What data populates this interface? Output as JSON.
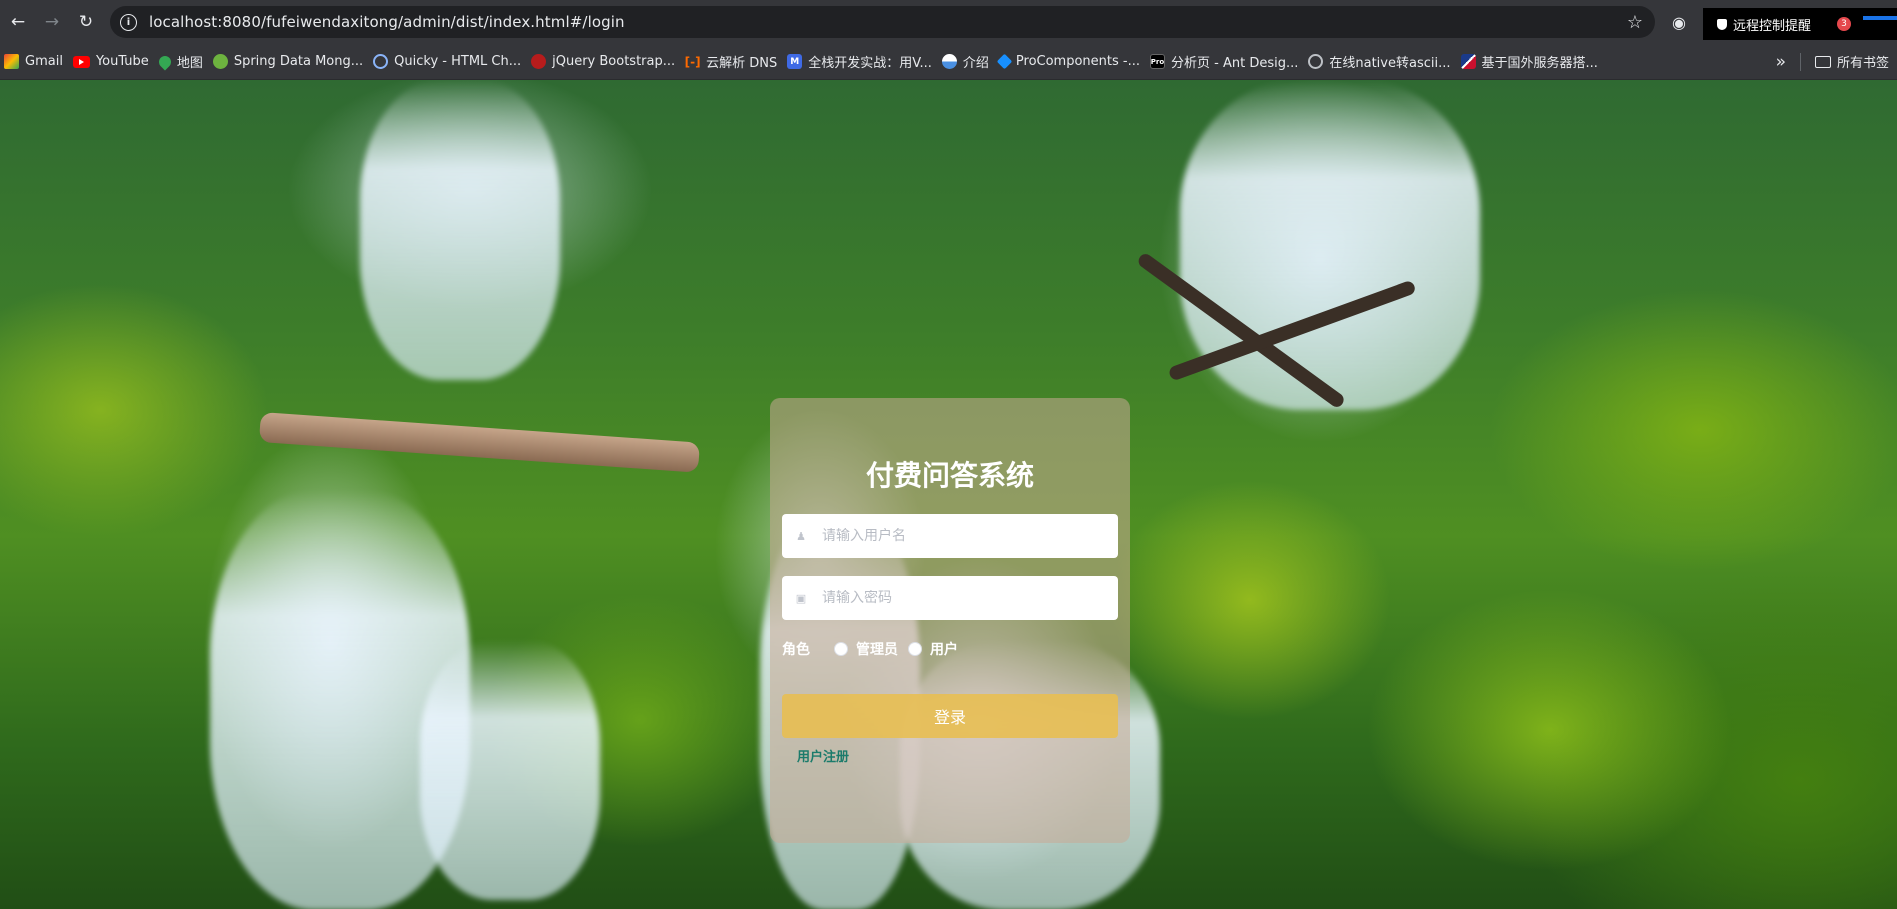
{
  "browser": {
    "url": "localhost:8080/fufeiwendaxitong/admin/dist/index.html#/login",
    "remote_notice": "远程控制提醒",
    "notification_count": "3",
    "bookmarks": [
      {
        "label": "Gmail",
        "icon": "gmail-icon"
      },
      {
        "label": "YouTube",
        "icon": "youtube-icon"
      },
      {
        "label": "地图",
        "icon": "maps-icon"
      },
      {
        "label": "Spring Data Mong...",
        "icon": "spring-icon"
      },
      {
        "label": "Quicky - HTML Ch...",
        "icon": "quicky-icon"
      },
      {
        "label": "jQuery Bootstrap...",
        "icon": "jquery-icon"
      },
      {
        "label": "云解析 DNS",
        "icon": "dns-icon"
      },
      {
        "label": "全栈开发实战：用V...",
        "icon": "m-icon"
      },
      {
        "label": "介绍",
        "icon": "intro-icon"
      },
      {
        "label": "ProComponents -...",
        "icon": "procomponents-icon"
      },
      {
        "label": "分析页 - Ant Desig...",
        "icon": "ant-design-pro-icon"
      },
      {
        "label": "在线native转ascii...",
        "icon": "globe-icon"
      },
      {
        "label": "基于国外服务器搭...",
        "icon": "flag-icon"
      }
    ],
    "all_bookmarks": "所有书签"
  },
  "login": {
    "title": "付费问答系统",
    "username_placeholder": "请输入用户名",
    "password_placeholder": "请输入密码",
    "role_label": "角色",
    "role_options": [
      "管理员",
      "用户"
    ],
    "login_button": "登录",
    "register_link": "用户注册"
  },
  "colors": {
    "login_button": "#e8be50",
    "register_link": "#1b7b6b"
  }
}
